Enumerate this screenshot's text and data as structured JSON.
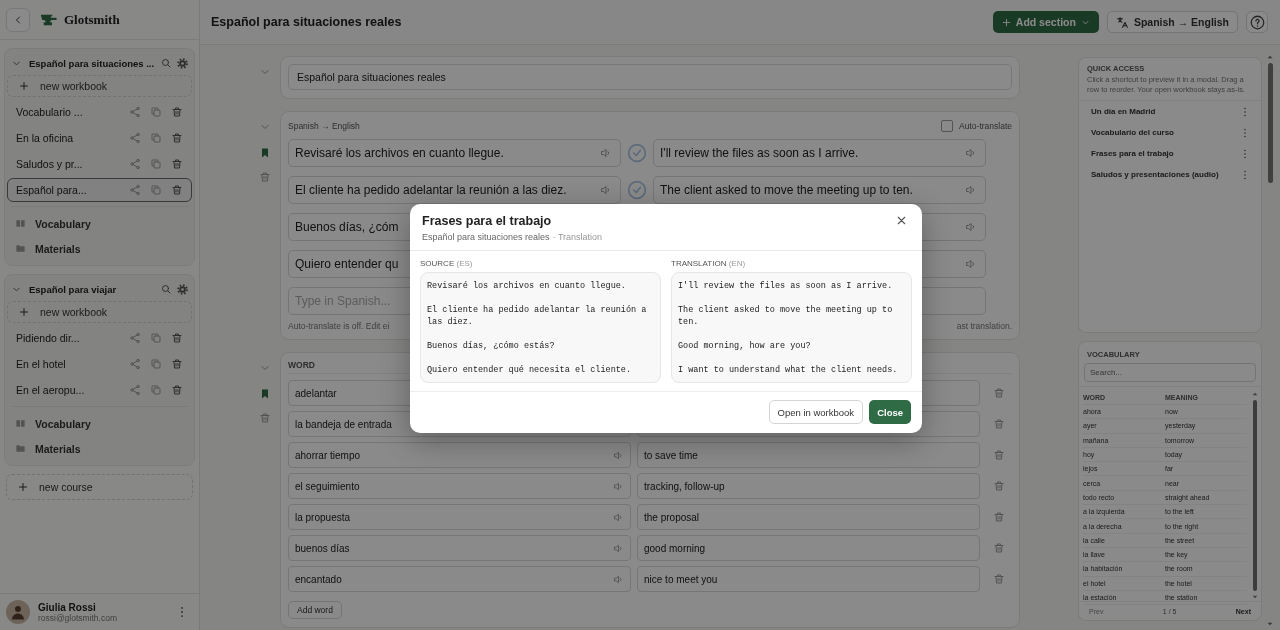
{
  "app": {
    "name": "Glotsmith"
  },
  "sidebar": {
    "courses": [
      {
        "title": "Español para situaciones ...",
        "new_workbook": "new workbook",
        "workbooks": [
          {
            "title": "Vocabulario ...",
            "selected": false
          },
          {
            "title": "En la oficina",
            "selected": false
          },
          {
            "title": "Saludos y pr...",
            "selected": false
          },
          {
            "title": "Español para...",
            "selected": true
          }
        ],
        "links": [
          {
            "kind": "book",
            "label": "Vocabulary"
          },
          {
            "kind": "folder",
            "label": "Materials"
          }
        ]
      },
      {
        "title": "Español para viajar",
        "new_workbook": "new workbook",
        "workbooks": [
          {
            "title": "Pidiendo dir...",
            "selected": false
          },
          {
            "title": "En el hotel",
            "selected": false
          },
          {
            "title": "En el aeropu...",
            "selected": false
          }
        ],
        "links": [
          {
            "kind": "book",
            "label": "Vocabulary"
          },
          {
            "kind": "folder",
            "label": "Materials"
          }
        ]
      }
    ],
    "new_course": "new course",
    "user": {
      "name": "Giulia Rossi",
      "email": "rossi@glotsmith.com"
    }
  },
  "header": {
    "title": "Español para situaciones reales",
    "add_section": "Add section",
    "language_pair": "Spanish → English"
  },
  "title_section": {
    "value": "Español para situaciones reales"
  },
  "translation_section": {
    "language_label": "Spanish → English",
    "auto_translate": {
      "label": "Auto-translate",
      "checked": false
    },
    "rows": [
      {
        "source": "Revisaré los archivos en cuanto llegue.",
        "target": "I'll review the files as soon as I arrive."
      },
      {
        "source": "El cliente ha pedido adelantar la reunión a las diez.",
        "target": "The client asked to move the meeting up to ten."
      },
      {
        "source": "Buenos días, ¿cóm"
      },
      {
        "source": "Quiero entender qu"
      }
    ],
    "input_placeholder": "Type in Spanish...",
    "note_start": "Auto-translate is off. Edit ei",
    "note_end": "ast translation."
  },
  "vocabulary_section": {
    "column_word": "WORD",
    "rows": [
      {
        "word": "adelantar"
      },
      {
        "word": "la bandeja de entrada"
      },
      {
        "word": "ahorrar tiempo",
        "meaning": "to save time"
      },
      {
        "word": "el seguimiento",
        "meaning": "tracking, follow-up"
      },
      {
        "word": "la propuesta",
        "meaning": "the proposal"
      },
      {
        "word": "buenos días",
        "meaning": "good morning"
      },
      {
        "word": "encantado",
        "meaning": "nice to meet you"
      }
    ],
    "add_word": "Add word"
  },
  "quick_access": {
    "title": "QUICK ACCESS",
    "hint": "Click a shortcut to preview it in a modal. Drag a row to reorder. Your open workbook stays as-is.",
    "items": [
      "Un día en Madrid",
      "Vocabulario del curso",
      "Frases para el trabajo",
      "Saludos y presentaciones (audio)"
    ]
  },
  "vocab_panel": {
    "title": "VOCABULARY",
    "search_placeholder": "Search...",
    "columns": [
      "WORD",
      "MEANING"
    ],
    "rows": [
      {
        "word": "ahora",
        "meaning": "now"
      },
      {
        "word": "ayer",
        "meaning": "yesterday"
      },
      {
        "word": "mañana",
        "meaning": "tomorrow"
      },
      {
        "word": "hoy",
        "meaning": "today"
      },
      {
        "word": "lejos",
        "meaning": "far"
      },
      {
        "word": "cerca",
        "meaning": "near"
      },
      {
        "word": "todo recto",
        "meaning": "straight ahead"
      },
      {
        "word": "a la izquierda",
        "meaning": "to the left"
      },
      {
        "word": "a la derecha",
        "meaning": "to the right"
      },
      {
        "word": "la calle",
        "meaning": "the street"
      },
      {
        "word": "la llave",
        "meaning": "the key"
      },
      {
        "word": "la habitación",
        "meaning": "the room"
      },
      {
        "word": "el hotel",
        "meaning": "the hotel"
      },
      {
        "word": "la estación",
        "meaning": "the station"
      }
    ],
    "pager": {
      "prev": "Prev",
      "prev_disabled": true,
      "page": "1 / 5",
      "next": "Next"
    }
  },
  "modal": {
    "title": "Frases para el trabajo",
    "course": "Español para situaciones reales",
    "kind_label": "· Translation",
    "source_label": "SOURCE",
    "source_lang": "(ES)",
    "source_text": [
      "Revisaré los archivos en cuanto llegue.",
      "El cliente ha pedido adelantar la reunión a las diez.",
      "Buenos días, ¿cómo estás?",
      "Quiero entender qué necesita el cliente."
    ],
    "translation_label": "TRANSLATION",
    "translation_lang": "(EN)",
    "translation_text": [
      "I'll review the files as soon as I arrive.",
      "The client asked to move the meeting up to ten.",
      "Good morning, how are you?",
      "I want to understand what the client needs."
    ],
    "open_button": "Open in workbook",
    "close_button": "Close"
  }
}
